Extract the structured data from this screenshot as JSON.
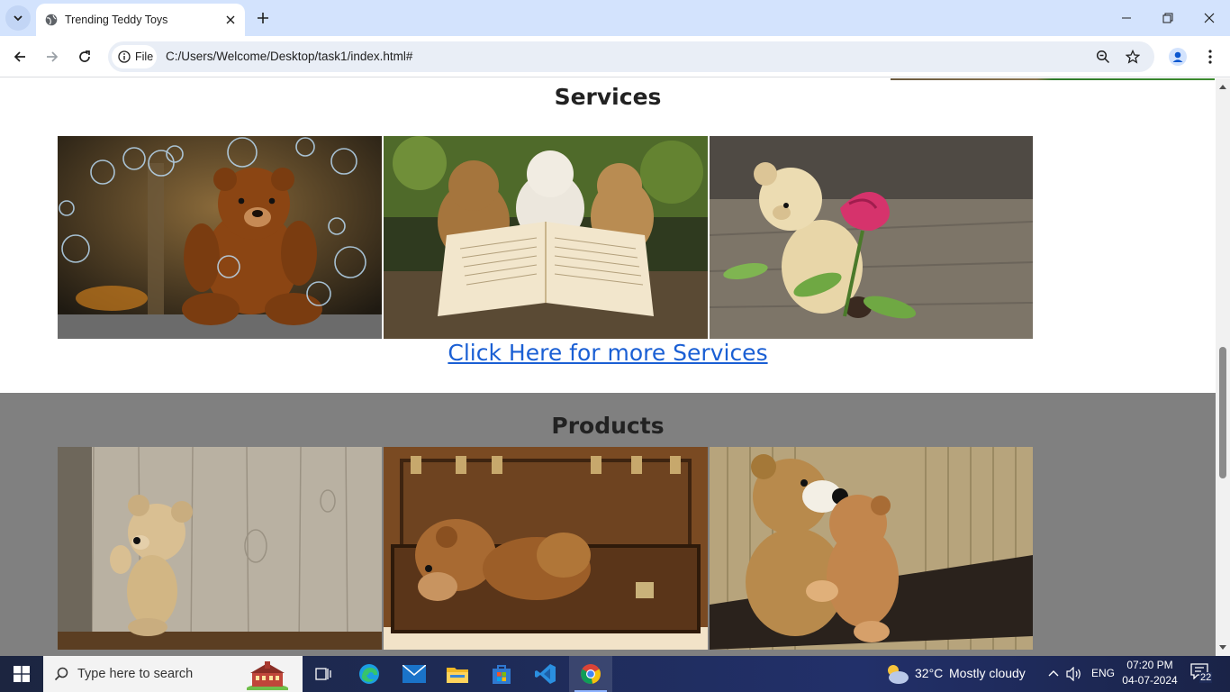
{
  "browser": {
    "tab_title": "Trending Teddy Toys",
    "chip_label": "File",
    "url": "C:/Users/Welcome/Desktop/task1/index.html#"
  },
  "page": {
    "services_title": "Services",
    "services_link": "Click Here for more Services",
    "products_title": "Products",
    "colors": {
      "link": "#1a5fd4",
      "products_bg": "#808080"
    }
  },
  "taskbar": {
    "search_placeholder": "Type here to search",
    "weather_temp": "32°C",
    "weather_text": "Mostly cloudy",
    "language": "ENG",
    "time": "07:20 PM",
    "date": "04-07-2024",
    "notification_count": "22"
  }
}
